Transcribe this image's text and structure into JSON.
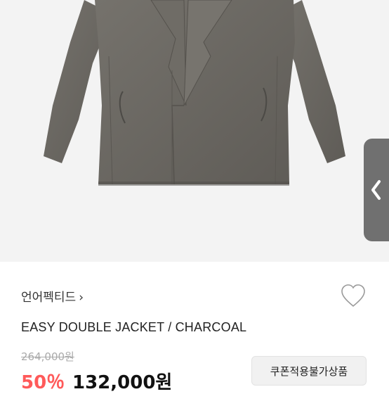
{
  "product": {
    "brand_label": "언어펙티드",
    "chevron": "›",
    "title": "EASY DOUBLE JACKET / CHARCOAL",
    "original_price": "264,000원",
    "discount_rate": "50％",
    "price": "132,000원",
    "coupon_badge": "쿠폰적용불가상품"
  },
  "icons": {
    "wishlist": "heart-outline-icon",
    "side_tab": "chevron-left-icon"
  },
  "colors": {
    "discount": "#ff5a5a",
    "side_tab": "#707070",
    "jacket": "#6b6862"
  }
}
